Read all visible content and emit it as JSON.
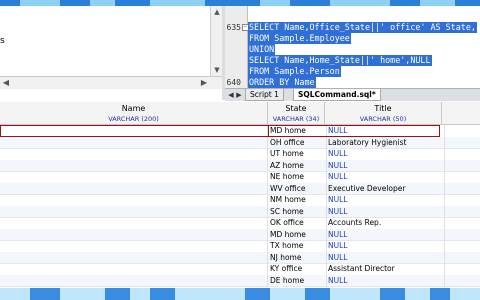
{
  "left_panel": {
    "text": "s"
  },
  "editor": {
    "lines": [
      {
        "num": "635",
        "fold": "−",
        "code": "SELECT Name,Office_State||' office' AS State,"
      },
      {
        "num": "",
        "fold": "",
        "code": "FROM Sample.Employee"
      },
      {
        "num": "",
        "fold": "",
        "code": "UNION"
      },
      {
        "num": "",
        "fold": "",
        "code": "SELECT Name,Home_State||' home',NULL"
      },
      {
        "num": "",
        "fold": "",
        "code": "FROM Sample.Person"
      },
      {
        "num": "640",
        "fold": "",
        "code": "ORDER BY Name"
      }
    ],
    "tabs": [
      {
        "label": "Script 1"
      },
      {
        "label": "SQLCommand.sql*"
      }
    ]
  },
  "grid": {
    "columns": [
      {
        "name": "Name",
        "type": "VARCHAR (200)"
      },
      {
        "name": "State",
        "type": "VARCHAR (34)"
      },
      {
        "name": "Title",
        "type": "VARCHAR (50)"
      }
    ],
    "rows": [
      {
        "state": "MD home",
        "title": "NULL",
        "null": true
      },
      {
        "state": "OH office",
        "title": "Laboratory Hygienist",
        "null": false
      },
      {
        "state": "UT home",
        "title": "NULL",
        "null": true
      },
      {
        "state": "AZ home",
        "title": "NULL",
        "null": true
      },
      {
        "state": "NE home",
        "title": "NULL",
        "null": true
      },
      {
        "state": "WV office",
        "title": "Executive Developer",
        "null": false
      },
      {
        "state": "NM home",
        "title": "NULL",
        "null": true
      },
      {
        "state": "SC home",
        "title": "NULL",
        "null": true
      },
      {
        "state": "OK office",
        "title": "Accounts Rep.",
        "null": false
      },
      {
        "state": "MD home",
        "title": "NULL",
        "null": true
      },
      {
        "state": "TX home",
        "title": "NULL",
        "null": true
      },
      {
        "state": "NJ home",
        "title": "NULL",
        "null": true
      },
      {
        "state": "KY office",
        "title": "Assistant Director",
        "null": false
      },
      {
        "state": "DE home",
        "title": "NULL",
        "null": true
      }
    ]
  },
  "colors": {
    "selection": "#2f6fd6",
    "null_text": "#1f3cc8",
    "type_text": "#2030a0",
    "selected_row_border": "#a01010"
  }
}
